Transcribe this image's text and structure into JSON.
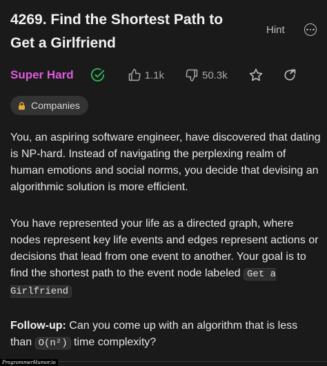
{
  "problem": {
    "title": "4269. Find the Shortest Path to Get a Girlfriend",
    "hint_label": "Hint",
    "difficulty": "Super Hard",
    "likes": "1.1k",
    "dislikes": "50.3k",
    "companies_label": "Companies"
  },
  "description": {
    "p1": "You, an aspiring software engineer, have discovered that dating is NP-hard. Instead of navigating the perplexing realm of human emotions and social norms, you decide that devising an algorithmic solution is more efficient.",
    "p2_text": "You have represented your life as a directed graph, where nodes represent key life events and edges represent actions or decisions that lead from one event to another. Your goal is to find the shortest path to the event node labeled ",
    "p2_code": "Get a Girlfriend",
    "followup_label": "Follow-up:",
    "followup_text": " Can you come up with an algorithm that is less than ",
    "followup_code": "O(n²)",
    "followup_tail": " time complexity?"
  },
  "colors": {
    "difficulty": "#e05ae0",
    "solved_check": "#2cbb5d",
    "background": "#1a1a1a"
  },
  "icons": [
    "more-icon",
    "check-circle-icon",
    "thumbs-up-icon",
    "thumbs-down-icon",
    "star-icon",
    "share-icon",
    "lock-icon"
  ],
  "watermark": "ProgrammerHumor.io"
}
